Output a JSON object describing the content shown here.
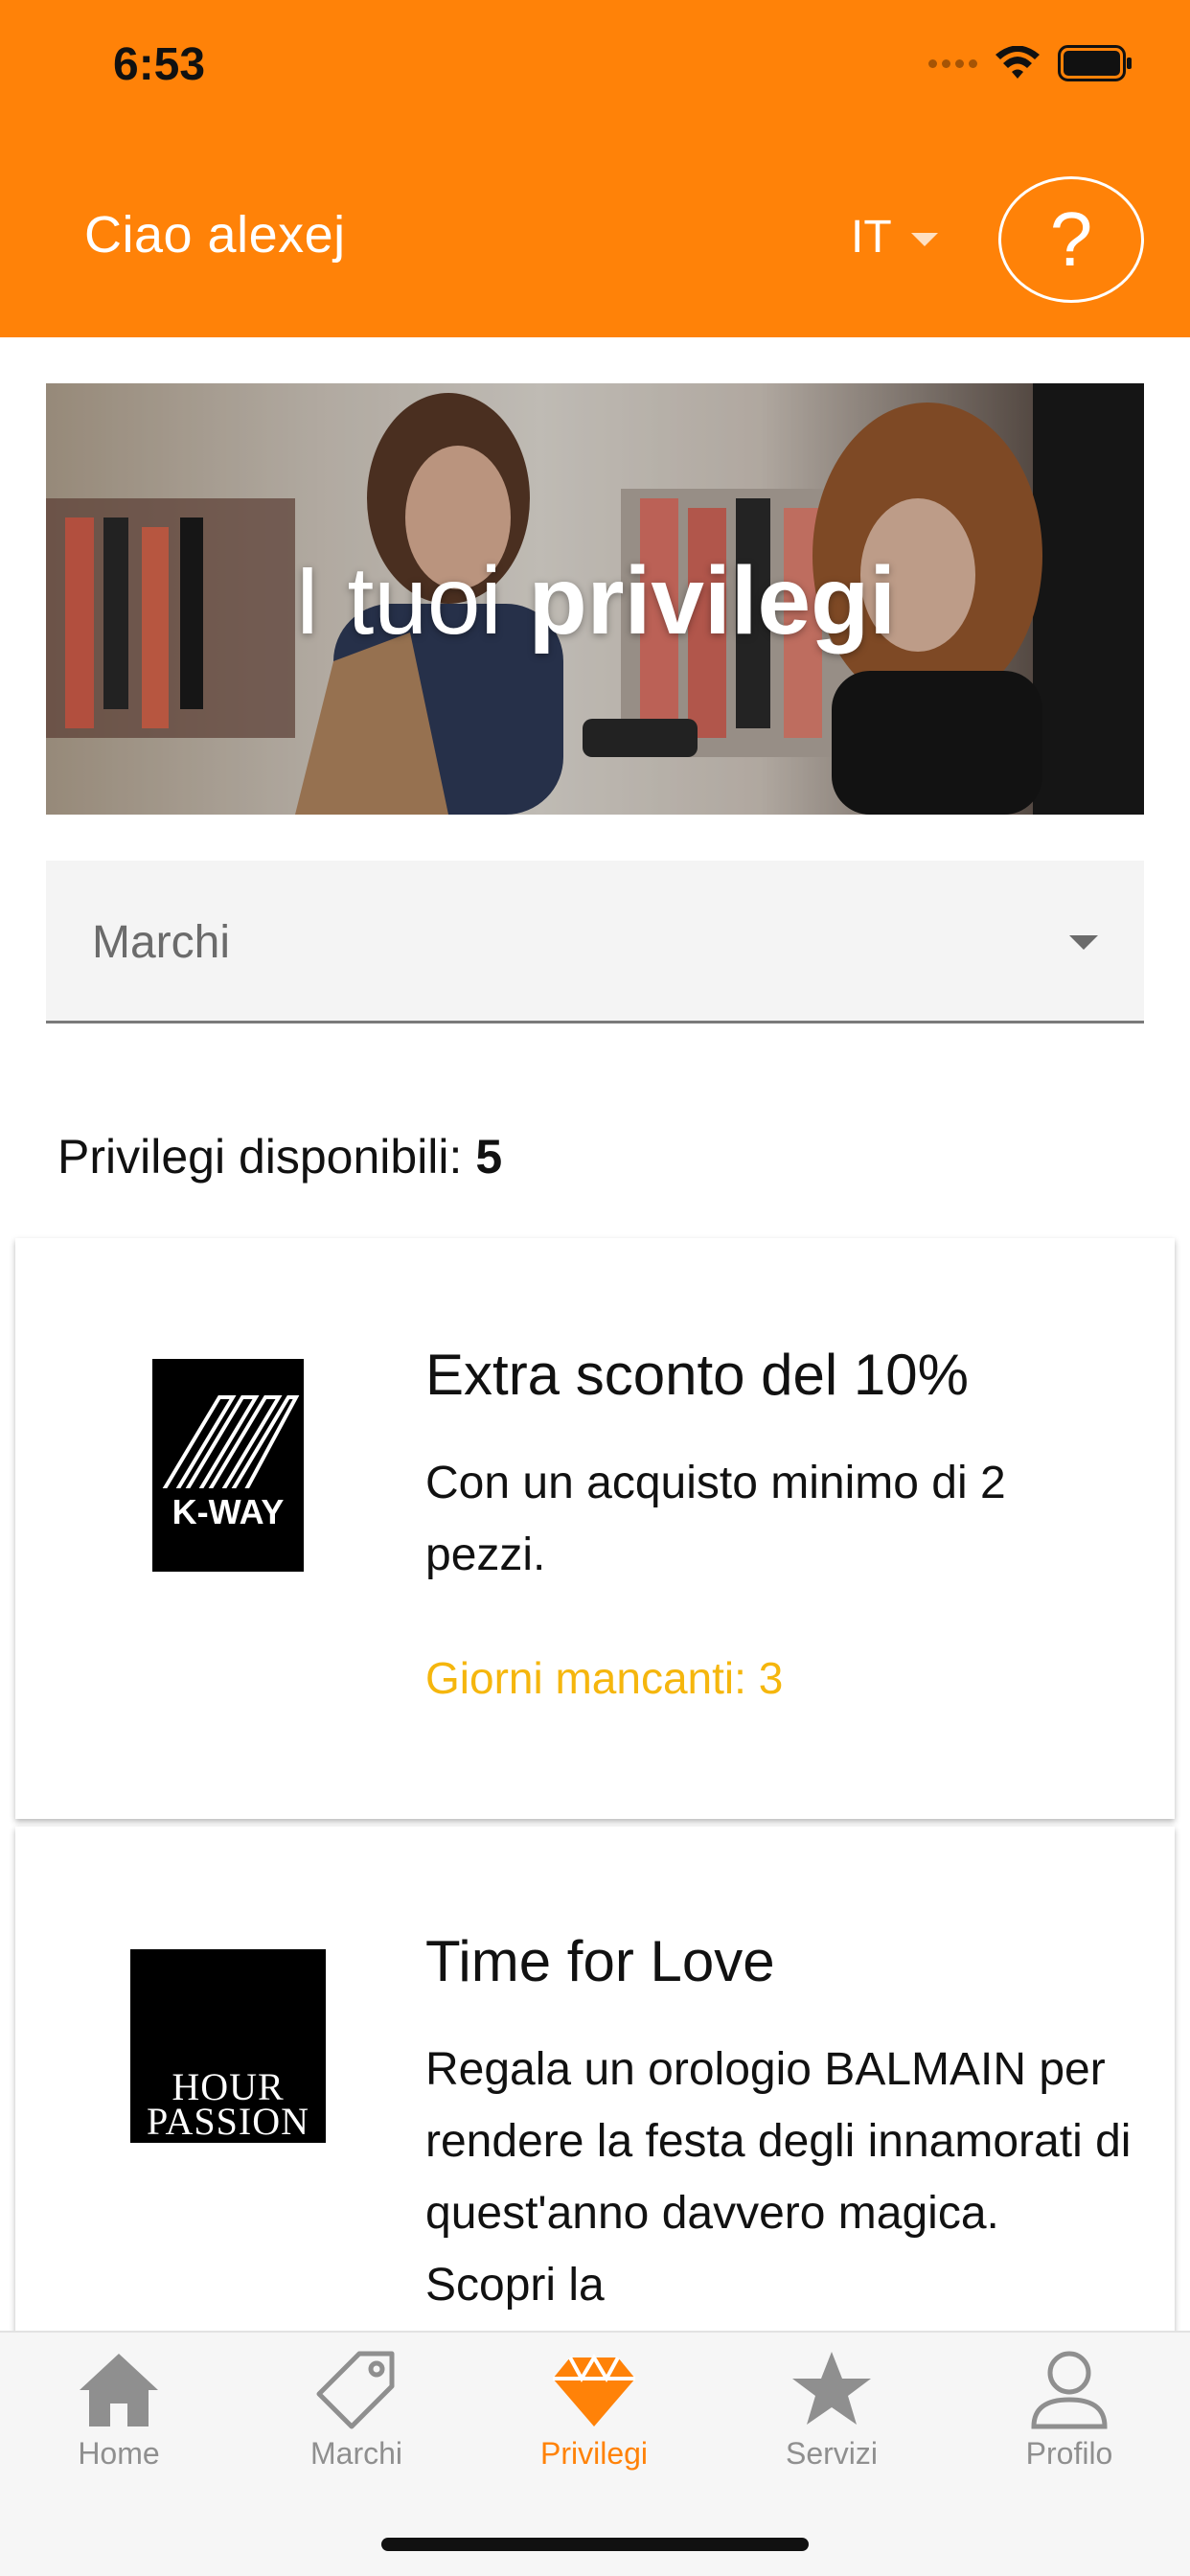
{
  "status_bar": {
    "time": "6:53"
  },
  "header": {
    "greeting": "Ciao alexej",
    "language": "IT",
    "help_label": "?"
  },
  "hero": {
    "title_light": "I tuoi",
    "title_bold": "privilegi"
  },
  "filter": {
    "selected": "Marchi"
  },
  "summary": {
    "label": "Privilegi disponibili:",
    "count": "5"
  },
  "privileges": [
    {
      "brand_logo": "K-WAY",
      "title": "Extra sconto del 10%",
      "description": "Con un acquisto minimo di 2 pezzi.",
      "days_left": "Giorni mancanti: 3"
    },
    {
      "brand_logo_line1": "HOUR",
      "brand_logo_line2": "PASSION",
      "title": "Time for Love",
      "description": "Regala un orologio BALMAIN per rendere la festa degli innamorati di quest'anno davvero magica. Scopri la"
    }
  ],
  "tabbar": {
    "items": [
      {
        "label": "Home",
        "icon": "home-icon"
      },
      {
        "label": "Marchi",
        "icon": "tag-icon"
      },
      {
        "label": "Privilegi",
        "icon": "diamond-icon",
        "active": true
      },
      {
        "label": "Servizi",
        "icon": "star-icon"
      },
      {
        "label": "Profilo",
        "icon": "user-icon"
      }
    ]
  },
  "colors": {
    "accent": "#ff8208",
    "days_left": "#f5b60d"
  }
}
